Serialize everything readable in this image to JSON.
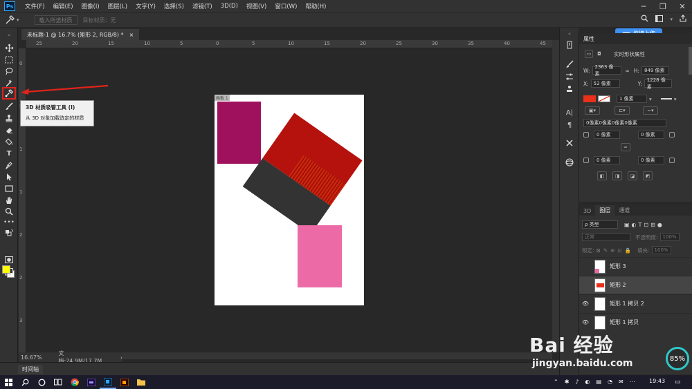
{
  "app": {
    "logo_text": "Ps",
    "menu": [
      "文件(F)",
      "编辑(E)",
      "图像(I)",
      "图层(L)",
      "文字(Y)",
      "选择(S)",
      "滤镜(T)",
      "3D(D)",
      "视图(V)",
      "窗口(W)",
      "帮助(H)"
    ]
  },
  "options_bar": {
    "load_selected_label": "载入所选材质",
    "target_material_label": "目标材质：无"
  },
  "upload_button": {
    "label": "拖拽上传"
  },
  "document": {
    "tab_label": "未标题-1 @ 16.7% (矩形 2, RGB/8) *",
    "close": "×",
    "artboard_label": "画板 1",
    "ruler_top_ticks": [
      "25",
      "20",
      "15",
      "10",
      "5",
      "0",
      "5",
      "10",
      "15",
      "20",
      "25",
      "30",
      "35",
      "40",
      "45"
    ],
    "ruler_left_ticks": [
      "0",
      "5",
      "1",
      "1",
      "2",
      "2",
      "3"
    ]
  },
  "status_bar": {
    "zoom": "16.67%",
    "doc_size": "文档:24.9M/17.7M",
    "arrow": "›"
  },
  "timeline": {
    "label": "时间轴"
  },
  "tooltip": {
    "title": "3D 材质吸管工具 (I)",
    "description": "从 3D 对象加载选定的材质"
  },
  "properties": {
    "title": "属性",
    "subtitle": "实时形状属性",
    "w_label": "W:",
    "w_value": "2363 像素",
    "h_label": "H:",
    "h_value": "849 像素",
    "x_label": "X:",
    "x_value": "52 像素",
    "y_label": "Y:",
    "y_value": "1228 像素",
    "stroke_value": "1 像素",
    "corners_all": "0像素0像素0像素0像素",
    "corner_value": "0 像素",
    "fill_color": "#e8301a"
  },
  "layers": {
    "tabs": [
      "3D",
      "图层",
      "通道"
    ],
    "active_tab": "图层",
    "filter_label": "ρ 类型",
    "blend_mode": "正常",
    "opacity_label": "不透明度:",
    "opacity_value": "100%",
    "lock_label": "锁定:",
    "fill_label": "填充:",
    "fill_value": "100%",
    "items": [
      {
        "name": "矩形 3",
        "visible": false,
        "selected": false
      },
      {
        "name": "矩形 2",
        "visible": false,
        "selected": true
      },
      {
        "name": "矩形 1 拷贝 2",
        "visible": true,
        "selected": false
      },
      {
        "name": "矩形 1 拷贝",
        "visible": true,
        "selected": false
      }
    ]
  },
  "taskbar": {
    "time": "19:43"
  },
  "perf_widget": {
    "value": "85%"
  },
  "watermark": {
    "main": "Bai 经验",
    "url": "jingyan.baidu.com"
  },
  "colors": {
    "annotation_red": "#e2231a",
    "purple_rect": "#a0115d",
    "pink_rect": "#ec6ba6",
    "red_rect": "#b5120e",
    "dark_rect": "#333333",
    "foreground": "#ffff00",
    "background": "#ffffff",
    "accent_blue": "#3d8ff0"
  }
}
